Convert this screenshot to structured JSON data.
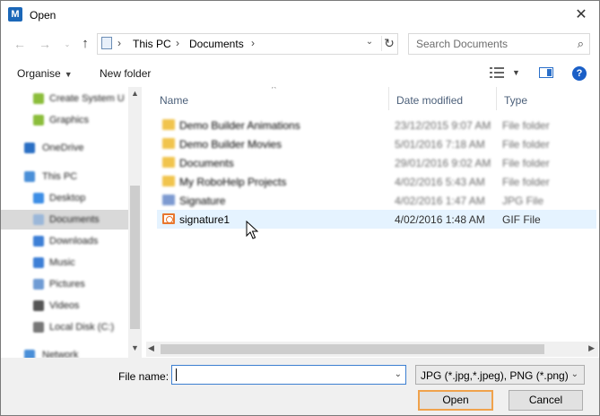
{
  "window": {
    "title": "Open",
    "app_icon": "M",
    "close_glyph": "✕"
  },
  "nav": {
    "back_glyph": "←",
    "forward_glyph": "→",
    "up_glyph": "↑",
    "address": [
      "This PC",
      "Documents"
    ],
    "chevron": "›",
    "dropdown_glyph": "⌄",
    "refresh_glyph": "↻",
    "search_placeholder": "Search Documents",
    "search_glyph": "⌕"
  },
  "toolbar": {
    "organise_label": "Organise",
    "new_folder_label": "New folder",
    "help_glyph": "?",
    "caret_glyph": "▼"
  },
  "sidebar": {
    "items": [
      {
        "label": "Create System U",
        "color": "#8bbd3b",
        "selected": false
      },
      {
        "label": "Graphics",
        "color": "#8bbd3b",
        "selected": false
      },
      {
        "label": "OneDrive",
        "color": "#2b6fc4",
        "selected": false
      },
      {
        "label": "This PC",
        "color": "#4a8fd8",
        "selected": false
      },
      {
        "label": "Desktop",
        "color": "#3d8ee6",
        "selected": false
      },
      {
        "label": "Documents",
        "color": "#9bb7d9",
        "selected": true
      },
      {
        "label": "Downloads",
        "color": "#3d7fd6",
        "selected": false
      },
      {
        "label": "Music",
        "color": "#3d7fd6",
        "selected": false
      },
      {
        "label": "Pictures",
        "color": "#6f9bd4",
        "selected": false
      },
      {
        "label": "Videos",
        "color": "#555555",
        "selected": false
      },
      {
        "label": "Local Disk (C:)",
        "color": "#777777",
        "selected": false
      },
      {
        "label": "Network",
        "color": "#4a8fd8",
        "selected": false
      }
    ]
  },
  "scroll": {
    "up_glyph": "▲",
    "down_glyph": "▼",
    "left_glyph": "◀",
    "right_glyph": "▶"
  },
  "columns": {
    "name": "Name",
    "date": "Date modified",
    "type": "Type",
    "sort_glyph": "^"
  },
  "files": [
    {
      "name": "Demo Builder Animations",
      "date": "23/12/2015 9:07 AM",
      "type": "File folder",
      "icon": "folder",
      "blurred": true
    },
    {
      "name": "Demo Builder Movies",
      "date": "5/01/2016 7:18 AM",
      "type": "File folder",
      "icon": "folder",
      "blurred": true
    },
    {
      "name": "Documents",
      "date": "29/01/2016 9:02 AM",
      "type": "File folder",
      "icon": "folder",
      "blurred": true
    },
    {
      "name": "My RoboHelp Projects",
      "date": "4/02/2016 5:43 AM",
      "type": "File folder",
      "icon": "folder",
      "blurred": true
    },
    {
      "name": "Signature",
      "date": "4/02/2016 1:47 AM",
      "type": "JPG File",
      "icon": "jpg",
      "blurred": true
    },
    {
      "name": "signature1",
      "date": "4/02/2016 1:48 AM",
      "type": "GIF File",
      "icon": "gif",
      "blurred": false
    }
  ],
  "footer": {
    "file_name_label": "File name:",
    "file_name_value": "",
    "filter": "JPG (*.jpg,*.jpeg), PNG (*.png),",
    "open_label": "Open",
    "cancel_label": "Cancel",
    "dropdown_glyph": "⌄"
  }
}
